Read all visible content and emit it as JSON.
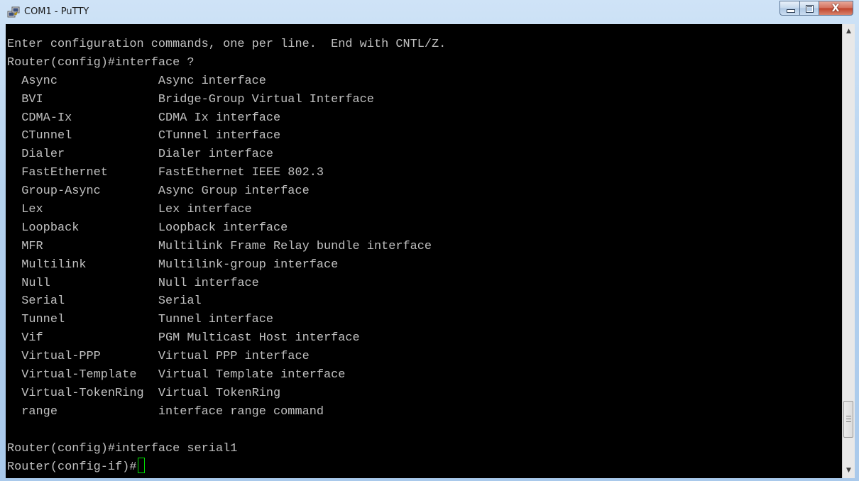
{
  "window": {
    "title": "COM1 - PuTTY",
    "icon": "putty-icon"
  },
  "caption": {
    "minimize_glyph": "",
    "maximize_glyph": "",
    "close_glyph": "X"
  },
  "terminal": {
    "lines": [
      "Enter configuration commands, one per line.  End with CNTL/Z.",
      "Router(config)#interface ?",
      "  Async              Async interface",
      "  BVI                Bridge-Group Virtual Interface",
      "  CDMA-Ix            CDMA Ix interface",
      "  CTunnel            CTunnel interface",
      "  Dialer             Dialer interface",
      "  FastEthernet       FastEthernet IEEE 802.3",
      "  Group-Async        Async Group interface",
      "  Lex                Lex interface",
      "  Loopback           Loopback interface",
      "  MFR                Multilink Frame Relay bundle interface",
      "  Multilink          Multilink-group interface",
      "  Null               Null interface",
      "  Serial             Serial",
      "  Tunnel             Tunnel interface",
      "  Vif                PGM Multicast Host interface",
      "  Virtual-PPP        Virtual PPP interface",
      "  Virtual-Template   Virtual Template interface",
      "  Virtual-TokenRing  Virtual TokenRing",
      "  range              interface range command",
      "",
      "Router(config)#interface serial1"
    ],
    "prompt": "Router(config-if)#"
  },
  "scrollbar": {
    "up_arrow": "▲",
    "down_arrow": "▼",
    "position_fraction": 0.93
  },
  "colors": {
    "terminal_bg": "#000000",
    "terminal_fg": "#c0c0c0",
    "cursor": "#00e000",
    "close_button": "#c0432b"
  }
}
